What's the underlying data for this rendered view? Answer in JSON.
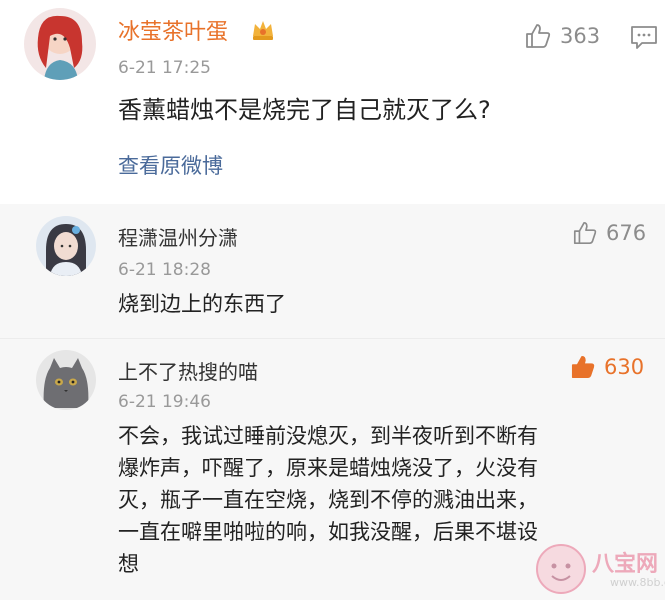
{
  "main_comment": {
    "username": "冰莹茶叶蛋",
    "time": "6-21 17:25",
    "text": "香薰蜡烛不是烧完了自己就灭了么?",
    "like_count": "363",
    "view_original_link": "查看原微博",
    "name_color": "#e8722a",
    "link_color": "#4a6a9a"
  },
  "replies": [
    {
      "username": "程潇温州分潇",
      "time": "6-21 18:28",
      "text": "烧到边上的东西了",
      "like_count": "676"
    },
    {
      "username": "上不了热搜的喵",
      "time": "6-21 19:46",
      "text_lines": [
        "不会，我试过睡前没熄灭，到半夜听到不断有",
        "爆炸声，吓醒了，原来是蜡烛烧没了，火没有",
        "灭，瓶子一直在空烧，烧到不停的溅油出来，",
        "一直在噼里啪啦的响，如我没醒，后果不堪设",
        "想"
      ],
      "like_count": "630",
      "liked": true,
      "like_color": "#e8722a"
    }
  ],
  "icons": {
    "like": "thumbs-up-icon",
    "comment": "comment-icon",
    "vip": "vip-badge-icon"
  },
  "watermark": {
    "text": "八宝网",
    "url": "www.8bb.com"
  }
}
